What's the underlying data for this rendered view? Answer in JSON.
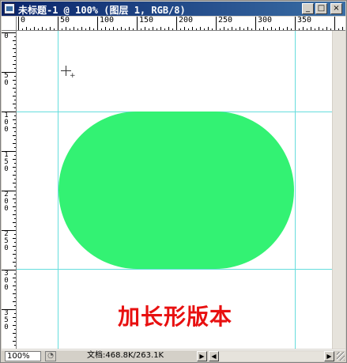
{
  "window": {
    "title": "未标题-1 @ 100% (图层 1, RGB/8)",
    "minimize_label": "_",
    "maximize_label": "□",
    "close_label": "×"
  },
  "rulers": {
    "top_labels": [
      "0",
      "50",
      "100",
      "150",
      "200",
      "250",
      "300",
      "350"
    ],
    "left_labels": [
      [
        "0"
      ],
      [
        "5",
        "0"
      ],
      [
        "1",
        "0",
        "0"
      ],
      [
        "1",
        "5",
        "0"
      ],
      [
        "2",
        "0",
        "0"
      ],
      [
        "2",
        "5",
        "0"
      ],
      [
        "3",
        "0",
        "0"
      ],
      [
        "3",
        "5",
        "0"
      ]
    ]
  },
  "canvas": {
    "shape_color": "#33f273",
    "guide_color": "#66dddd",
    "caption": "加长形版本",
    "caption_color": "#e81010"
  },
  "statusbar": {
    "zoom": "100%",
    "doc_info": "文档:468.8K/263.1K",
    "arrow_right": "▶",
    "arrow_left": "◀"
  }
}
